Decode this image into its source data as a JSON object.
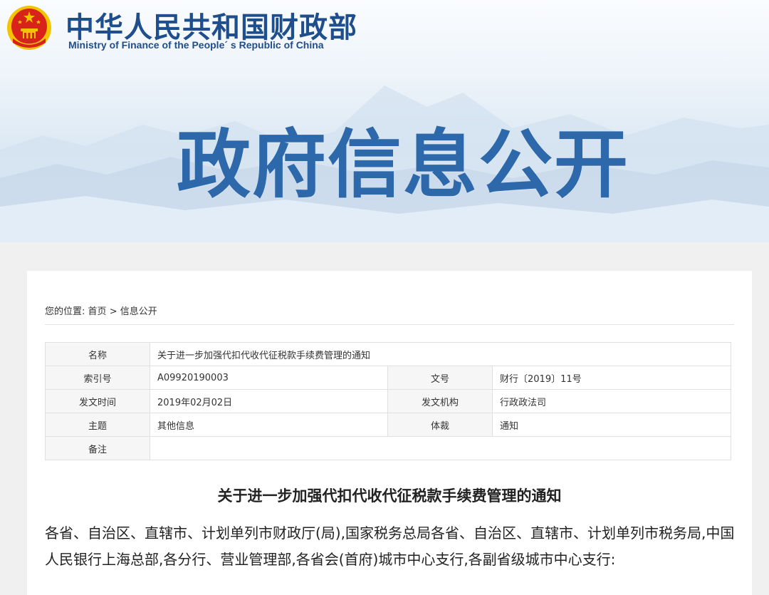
{
  "header": {
    "ministry_cn": "中华人民共和国财政部",
    "ministry_en": "Ministry of Finance of the People´ s Republic of China",
    "banner_title": "政府信息公开",
    "emblem_icon": "national-emblem-icon"
  },
  "breadcrumb": {
    "prefix": "您的位置:",
    "home": "首页",
    "separator": ">",
    "current": "信息公开"
  },
  "meta": {
    "name_label": "名称",
    "name_value": "关于进一步加强代扣代收代征税款手续费管理的通知",
    "index_label": "索引号",
    "index_value": "A09920190003",
    "docno_label": "文号",
    "docno_value": "财行〔2019〕11号",
    "date_label": "发文时间",
    "date_value": "2019年02月02日",
    "issuer_label": "发文机构",
    "issuer_value": "行政政法司",
    "topic_label": "主题",
    "topic_value": "其他信息",
    "genre_label": "体裁",
    "genre_value": "通知",
    "remark_label": "备注",
    "remark_value": ""
  },
  "document": {
    "title": "关于进一步加强代扣代收代征税款手续费管理的通知",
    "body": "各省、自治区、直辖市、计划单列市财政厅(局),国家税务总局各省、自治区、直辖市、计划单列市税务局,中国人民银行上海总部,各分行、营业管理部,各省会(首府)城市中心支行,各副省级城市中心支行:"
  },
  "colors": {
    "brand_blue": "#1f4e8c",
    "banner_title_blue": "#2d68ab",
    "emblem_red": "#d7231a",
    "emblem_gold": "#f5c400"
  }
}
